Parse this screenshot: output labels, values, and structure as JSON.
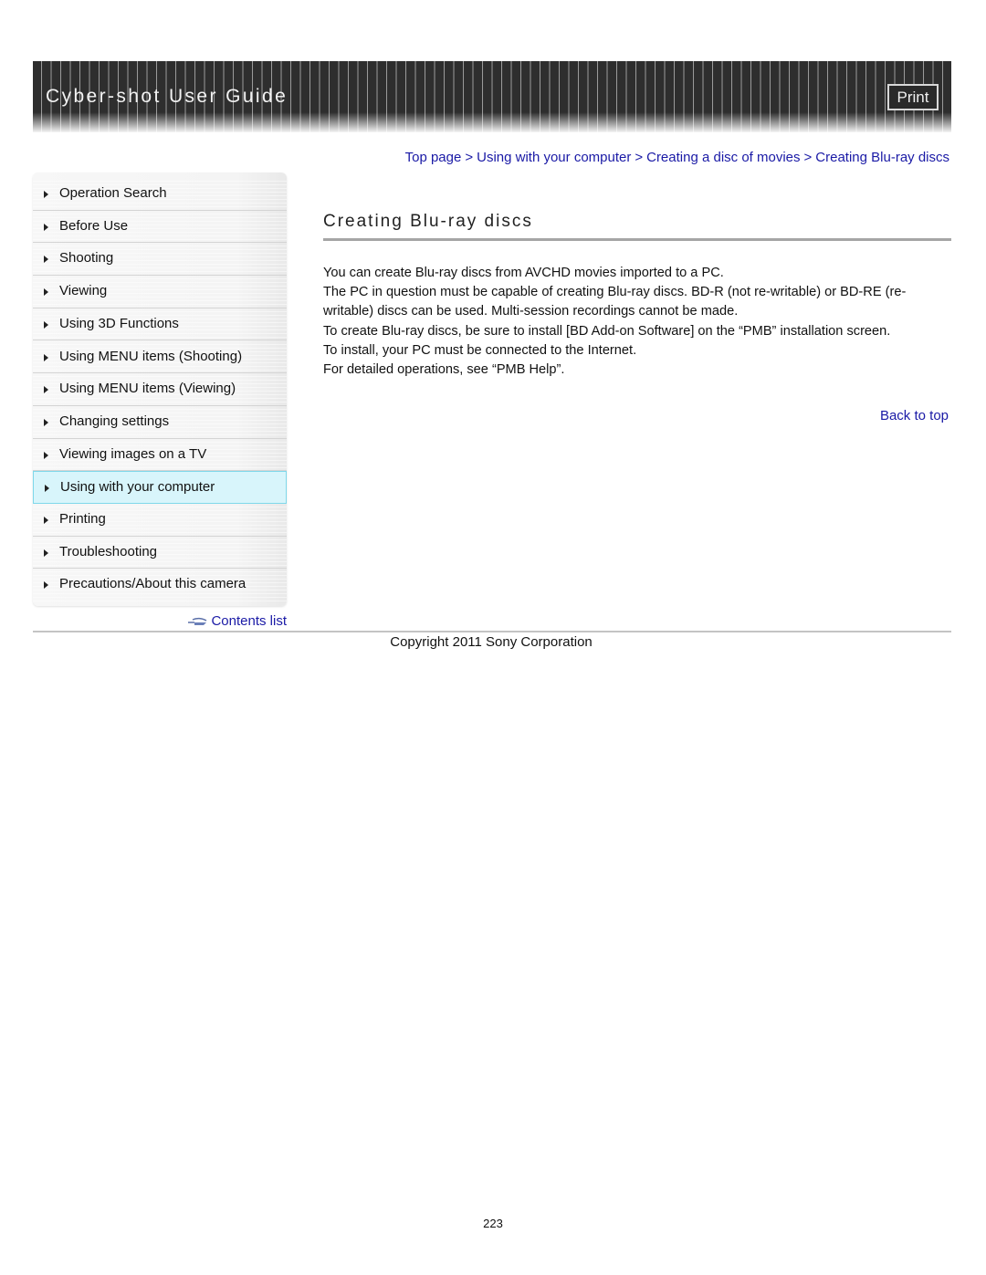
{
  "header": {
    "title": "Cyber-shot User Guide",
    "print_label": "Print"
  },
  "breadcrumb": {
    "items": [
      {
        "label": "Top page"
      },
      {
        "label": "Using with your computer"
      },
      {
        "label": "Creating a disc of movies"
      },
      {
        "label": "Creating Blu-ray discs"
      }
    ],
    "separator": ">"
  },
  "sidebar": {
    "items": [
      {
        "label": "Operation Search",
        "icon": "triangle-right-icon"
      },
      {
        "label": "Before Use",
        "icon": "triangle-right-icon"
      },
      {
        "label": "Shooting",
        "icon": "triangle-right-icon"
      },
      {
        "label": "Viewing",
        "icon": "triangle-right-icon"
      },
      {
        "label": "Using 3D Functions",
        "icon": "triangle-right-icon"
      },
      {
        "label": "Using MENU items (Shooting)",
        "icon": "triangle-right-icon"
      },
      {
        "label": "Using MENU items (Viewing)",
        "icon": "triangle-right-icon"
      },
      {
        "label": "Changing settings",
        "icon": "triangle-right-icon"
      },
      {
        "label": "Viewing images on a TV",
        "icon": "triangle-right-icon"
      },
      {
        "label": "Using with your computer",
        "icon": "triangle-right-icon",
        "active": true
      },
      {
        "label": "Printing",
        "icon": "triangle-right-icon"
      },
      {
        "label": "Troubleshooting",
        "icon": "triangle-right-icon"
      },
      {
        "label": "Precautions/About this camera",
        "icon": "triangle-right-icon"
      }
    ],
    "contents_link": {
      "label": "Contents list",
      "icon": "contents-arrow-icon"
    }
  },
  "main": {
    "title": "Creating Blu-ray discs",
    "paragraphs": [
      "You can create Blu-ray discs from AVCHD movies imported to a PC.",
      "The PC in question must be capable of creating Blu-ray discs. BD-R (not re-writable) or BD-RE (re-writable) discs can be used. Multi-session recordings cannot be made.",
      "To create Blu-ray discs, be sure to install [BD Add-on Software] on the “PMB” installation screen.",
      "To install, your PC must be connected to the Internet.",
      "For detailed operations, see “PMB Help”."
    ],
    "back_to_top": "Back to top"
  },
  "footer": {
    "copyright": "Copyright 2011 Sony Corporation",
    "page_number": "223"
  },
  "colors": {
    "link": "#1a1aa6",
    "active_item_bg": "#d8f5fb",
    "active_item_border": "#7fd8ea",
    "header_bg": "#333333"
  }
}
